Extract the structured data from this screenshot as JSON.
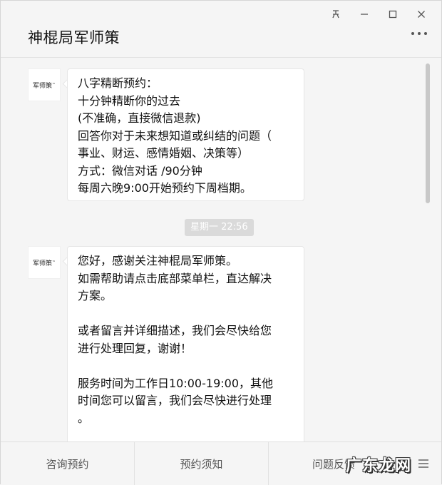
{
  "window": {
    "controls": [
      "кп",
      "—",
      "□",
      "✕"
    ]
  },
  "header": {
    "title": "神棍局军师策",
    "more_icon": "more-dots-icon"
  },
  "avatar": {
    "label": "军师策"
  },
  "messages": [
    {
      "lines": [
        "八字精断预约：",
        "十分钟精断你的过去",
        "(不准确，直接微信退款)",
        "回答你对于未来想知道或纠结的问题（",
        "事业、财运、感情婚姻、决策等）",
        "方式：微信对话 /90分钟",
        "每周六晚9:00开始预约下周档期。"
      ]
    },
    {
      "timestamp": "星期一 22:56",
      "lines": [
        "您好，感谢关注神棍局军师策。",
        "如需帮助请点击底部菜单栏，直达解决",
        "方案。",
        "",
        "或者留言并详细描述，我们会尽快给您",
        "进行处理回复，谢谢！",
        "",
        "服务时间为工作日10:00-19:00，其他",
        "时间您可以留言，我们会尽快进行处理",
        "。"
      ]
    }
  ],
  "menu": {
    "items": [
      "咨询预约",
      "预约须知",
      "问题反馈"
    ],
    "menu_icon": "hamburger-icon"
  },
  "watermark": "广东龙网"
}
